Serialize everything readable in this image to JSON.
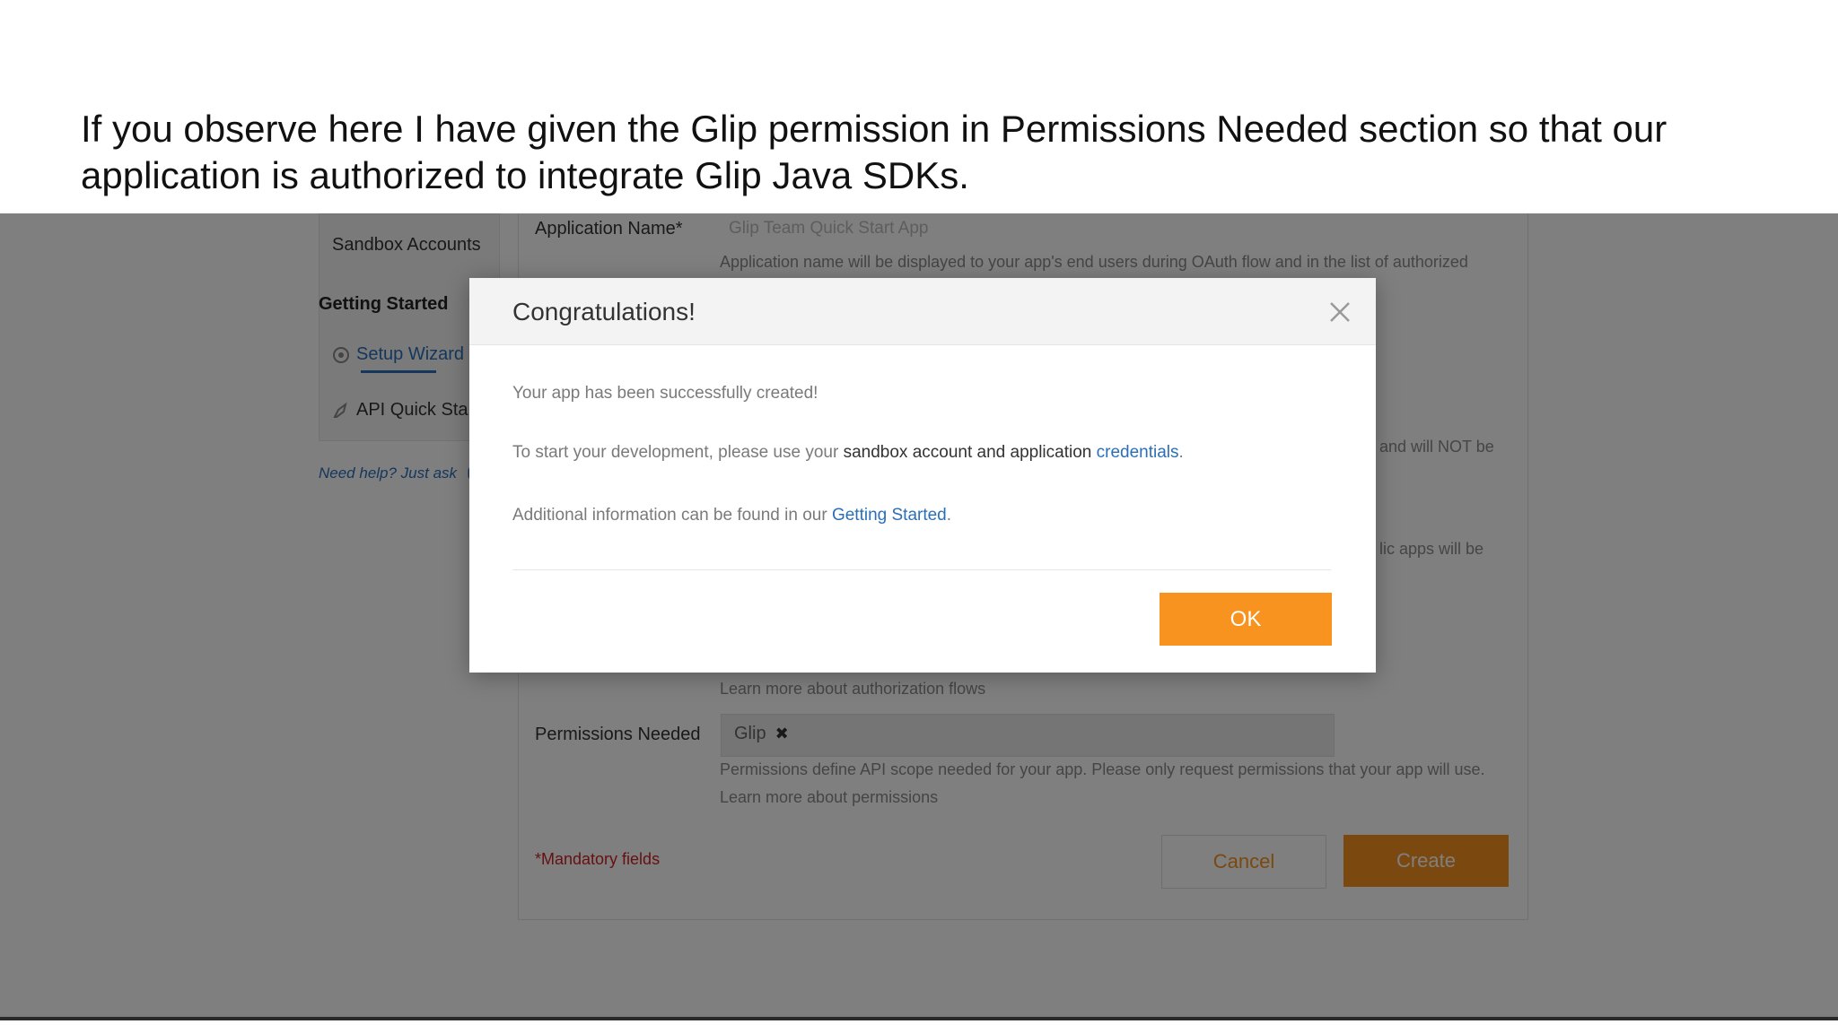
{
  "caption": "If you observe here I have given the Glip permission in Permissions Needed section so that our application is authorized to integrate Glip Java SDKs.",
  "sidebar": {
    "sandbox_accounts": "Sandbox Accounts",
    "getting_started": "Getting Started",
    "setup_wizard": "Setup Wizard",
    "api_quick_start": "API Quick Sta",
    "need_help": "Need help? Just ask"
  },
  "form": {
    "app_name_label": "Application Name*",
    "app_name_value": "Glip Team Quick Start App",
    "app_name_help": "Application name will be displayed to your app's end users during OAuth flow and in the list of authorized",
    "side_text_1": "and will NOT be",
    "side_text_2": "lic apps will be",
    "auth_flows_help": "Learn more about authorization flows",
    "permissions_label": "Permissions Needed",
    "permission_chip": "Glip",
    "permission_remove": "✖",
    "permissions_help": "Permissions define API scope needed for your app. Please only request permissions that your app will use.",
    "permissions_learn": "Learn more about permissions",
    "mandatory": "*Mandatory fields",
    "cancel_label": "Cancel",
    "create_label": "Create"
  },
  "modal": {
    "title": "Congratulations!",
    "line1": "Your app has been successfully created!",
    "line2_prefix": "To start your development, please use your ",
    "line2_dark": "sandbox account and application ",
    "line2_link": "credentials",
    "line2_suffix": ".",
    "line3_prefix": "Additional information can be found in our ",
    "line3_link": "Getting Started",
    "line3_suffix": ".",
    "ok_label": "OK"
  },
  "colors": {
    "accent_orange": "#f7931e",
    "link_blue": "#2b6fb8",
    "overlay": "rgba(0,0,0,0.5)"
  }
}
